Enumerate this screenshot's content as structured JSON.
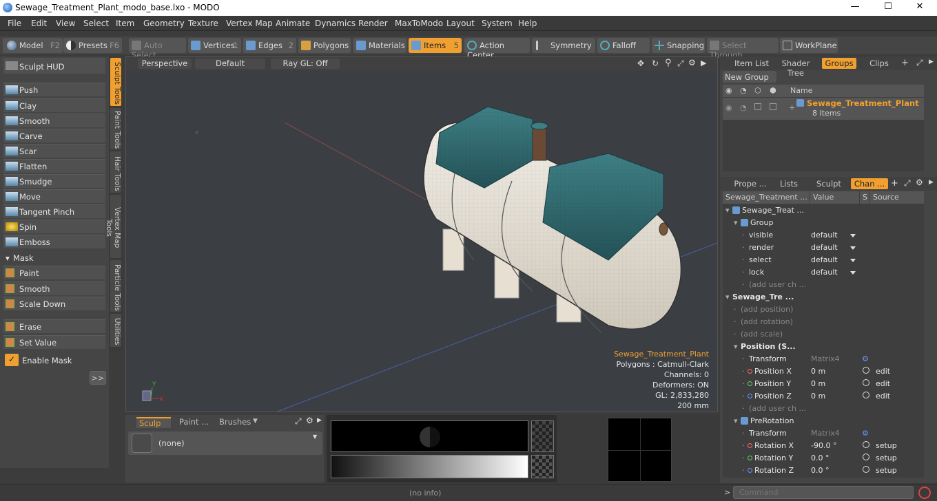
{
  "window": {
    "title": "Sewage_Treatment_Plant_modo_base.lxo - MODO",
    "minimize": "—",
    "maximize": "☐",
    "close": "✕"
  },
  "menu": [
    "File",
    "Edit",
    "View",
    "Select",
    "Item",
    "Geometry",
    "Texture",
    "Vertex Map",
    "Animate",
    "Dynamics",
    "Render",
    "MaxToModo",
    "Layout",
    "System",
    "Help"
  ],
  "toolbar": {
    "model": "Model",
    "model_key": "F2",
    "presets": "Presets",
    "presets_key": "F6",
    "auto_select": "Auto Select",
    "vertices": "Vertices",
    "vertices_key": "1",
    "edges": "Edges",
    "edges_key": "2",
    "polygons": "Polygons",
    "materials": "Materials",
    "items": "Items",
    "items_key": "5",
    "action_center": "Action Center",
    "symmetry": "Symmetry",
    "falloff": "Falloff",
    "snapping": "Snapping",
    "select_through": "Select Through",
    "workplane": "WorkPlane"
  },
  "sculpt": {
    "hud": "Sculpt HUD",
    "tools": [
      "Push",
      "Clay",
      "Smooth",
      "Carve",
      "Scar",
      "Flatten",
      "Smudge",
      "Move",
      "Tangent Pinch",
      "Spin",
      "Emboss"
    ],
    "mask_label": "Mask",
    "mask_tools": [
      "Paint",
      "Smooth",
      "Scale Down"
    ],
    "erase": "Erase",
    "set_value": "Set Value",
    "enable_mask": "Enable Mask",
    "expand": ">>"
  },
  "vtabs": [
    "Sculpt Tools",
    "Paint Tools",
    "Hair Tools",
    "Vertex Map Tools",
    "Particle Tools",
    "Utilities"
  ],
  "viewport": {
    "view": "Perspective",
    "shading": "Default",
    "raygl": "Ray GL: Off",
    "axis_y": "Y",
    "axis_x": "X",
    "info": {
      "item": "Sewage_Treatment_Plant",
      "polygons": "Polygons : Catmull-Clark",
      "channels": "Channels: 0",
      "deformers": "Deformers: ON",
      "gl": "GL: 2,833,280",
      "size": "200 mm"
    }
  },
  "bottom_left": {
    "tabs": [
      "Sculp ...",
      "Paint ...",
      "Brushes"
    ],
    "brush": "(none)"
  },
  "groups_panel": {
    "tabs": [
      "Item List",
      "Shader Tree",
      "Groups",
      "Clips"
    ],
    "new_group": "New Group",
    "name_header": "Name",
    "group_name": "Sewage_Treatment_Plant",
    "group_count": "8 Items"
  },
  "channels_panel": {
    "tabs": [
      "Prope ...",
      "Lists",
      "Sculpt",
      "Chan ..."
    ],
    "headers": [
      "Sewage_Treatment ...",
      "Value",
      "S",
      "Source"
    ],
    "rows": [
      {
        "indent": 0,
        "name": "Sewage_Treat ...",
        "value": "",
        "src": "",
        "type": "item"
      },
      {
        "indent": 1,
        "name": "Group",
        "value": "",
        "src": "",
        "type": "item"
      },
      {
        "indent": 2,
        "name": "visible",
        "value": "default",
        "src": "",
        "type": "dd"
      },
      {
        "indent": 2,
        "name": "render",
        "value": "default",
        "src": "",
        "type": "dd"
      },
      {
        "indent": 2,
        "name": "select",
        "value": "default",
        "src": "",
        "type": "dd"
      },
      {
        "indent": 2,
        "name": "lock",
        "value": "default",
        "src": "",
        "type": "dd"
      },
      {
        "indent": 2,
        "name": "(add user ch ...",
        "value": "",
        "src": "",
        "type": "add"
      },
      {
        "indent": 0,
        "name": "Sewage_Tre ...",
        "value": "",
        "src": "",
        "type": "bold"
      },
      {
        "indent": 1,
        "name": "(add position)",
        "value": "",
        "src": "",
        "type": "add"
      },
      {
        "indent": 1,
        "name": "(add rotation)",
        "value": "",
        "src": "",
        "type": "add"
      },
      {
        "indent": 1,
        "name": "(add scale)",
        "value": "",
        "src": "",
        "type": "add"
      },
      {
        "indent": 1,
        "name": "Position (S...",
        "value": "",
        "src": "",
        "type": "bold"
      },
      {
        "indent": 2,
        "name": "Transform",
        "value": "Matrix4",
        "src": "",
        "type": "matrix"
      },
      {
        "indent": 2,
        "name": "Position X",
        "value": "0 m",
        "src": "edit",
        "type": "x"
      },
      {
        "indent": 2,
        "name": "Position Y",
        "value": "0 m",
        "src": "edit",
        "type": "y"
      },
      {
        "indent": 2,
        "name": "Position Z",
        "value": "0 m",
        "src": "edit",
        "type": "z"
      },
      {
        "indent": 2,
        "name": "(add user ch ...",
        "value": "",
        "src": "",
        "type": "add"
      },
      {
        "indent": 1,
        "name": "PreRotation",
        "value": "",
        "src": "",
        "type": "item"
      },
      {
        "indent": 2,
        "name": "Transform",
        "value": "Matrix4",
        "src": "",
        "type": "matrix"
      },
      {
        "indent": 2,
        "name": "Rotation X",
        "value": "-90.0 °",
        "src": "setup",
        "type": "x"
      },
      {
        "indent": 2,
        "name": "Rotation Y",
        "value": "0.0 °",
        "src": "setup",
        "type": "y"
      },
      {
        "indent": 2,
        "name": "Rotation Z",
        "value": "0.0 °",
        "src": "setup",
        "type": "z"
      }
    ]
  },
  "status": {
    "info": "(no info)",
    "command_placeholder": "Command"
  },
  "colors": {
    "accent": "#f0a030",
    "panel": "#454545",
    "tank": "#e8e2d8",
    "lid": "#2f6b70"
  }
}
